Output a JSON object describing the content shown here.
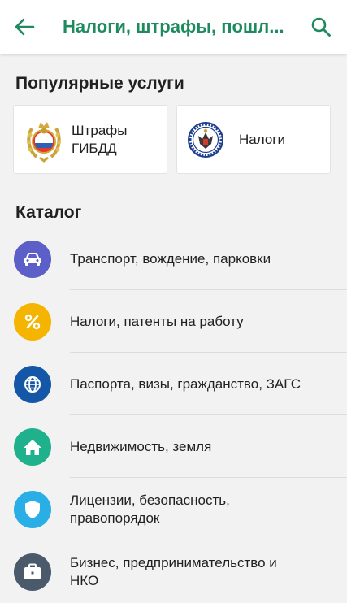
{
  "header": {
    "title": "Налоги, штрафы, пошл...",
    "accent_color": "#1f8a5f",
    "back_icon": "arrow-left-icon",
    "search_icon": "search-icon"
  },
  "popular": {
    "title": "Популярные услуги",
    "cards": [
      {
        "label": "Штрафы\nГИБДД",
        "icon": "gibdd-emblem-icon"
      },
      {
        "label": "Налоги",
        "icon": "tax-service-emblem-icon"
      }
    ]
  },
  "catalog": {
    "title": "Каталог",
    "items": [
      {
        "label": "Транспорт, вождение, парковки",
        "icon": "car-icon",
        "color": "#5b5fc7"
      },
      {
        "label": "Налоги, патенты на работу",
        "icon": "percent-icon",
        "color": "#f5b400"
      },
      {
        "label": "Паспорта, визы, гражданство, ЗАГС",
        "icon": "globe-icon",
        "color": "#1457a6"
      },
      {
        "label": "Недвижимость, земля",
        "icon": "house-icon",
        "color": "#1fb08c"
      },
      {
        "label": "Лицензии, безопасность,\nправопорядок",
        "icon": "shield-icon",
        "color": "#29aee6"
      },
      {
        "label": "Бизнес, предпринимательство и\nНКО",
        "icon": "briefcase-icon",
        "color": "#4b5a6b"
      }
    ]
  }
}
